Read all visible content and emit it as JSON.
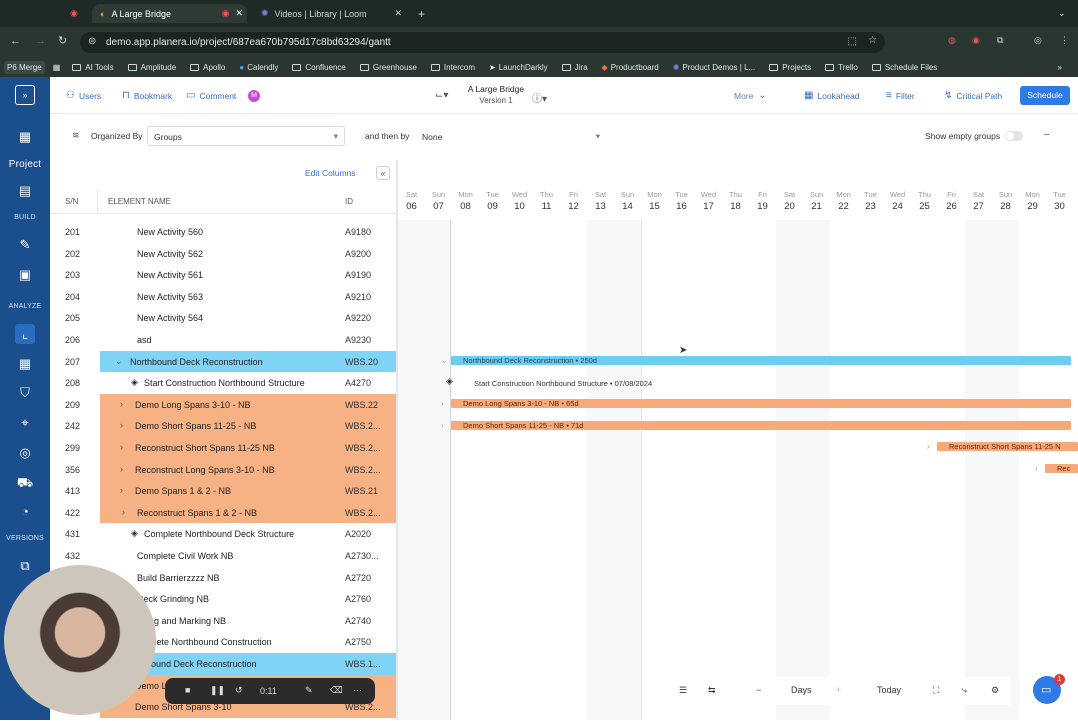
{
  "browser": {
    "tabs": [
      {
        "label": ""
      },
      {
        "label": "A Large Bridge"
      },
      {
        "label": "Videos | Library | Loom"
      }
    ],
    "url": "demo.app.planera.io/project/687ea670b795d17c8bd63294/gantt",
    "profile_label": "P6 Merge",
    "bookmarks": [
      "AI Tools",
      "Amplitude",
      "Apollo",
      "Calendly",
      "Confluence",
      "Greenhouse",
      "Intercom",
      "LaunchDarkly",
      "Jira",
      "Productboard",
      "Product Demos | L...",
      "Projects",
      "Trello",
      "Schedule Files"
    ]
  },
  "rail": {
    "project_label": "Project",
    "build_label": "BUILD",
    "analyze_label": "ANALYZE",
    "versions_label": "VERSIONS"
  },
  "toolbar": {
    "users": "Users",
    "bookmark": "Bookmark",
    "comment": "Comment",
    "avatar_letter": "M",
    "project_name": "A Large Bridge",
    "version": "Version 1",
    "more": "More",
    "lookahead": "Lookahead",
    "filter": "Filter",
    "critical_path": "Critical Path",
    "schedule": "Schedule"
  },
  "grouping": {
    "organized_by_label": "Organized By",
    "organized_by_value": "Groups",
    "then_by_label": "and then by",
    "then_by_value": "None",
    "show_empty_label": "Show empty groups"
  },
  "grid": {
    "edit_columns": "Edit Columns",
    "col_sn": "S/N",
    "col_name": "ELEMENT NAME",
    "col_id": "ID",
    "rows": [
      {
        "sn": "201",
        "name": "New Activity 560",
        "id": "A9180"
      },
      {
        "sn": "202",
        "name": "New Activity 562",
        "id": "A9200"
      },
      {
        "sn": "203",
        "name": "New Activity 561",
        "id": "A9190"
      },
      {
        "sn": "204",
        "name": "New Activity 563",
        "id": "A9210"
      },
      {
        "sn": "205",
        "name": "New Activity 564",
        "id": "A9220"
      },
      {
        "sn": "206",
        "name": "asd",
        "id": "A9230"
      },
      {
        "sn": "207",
        "name": "Northbound Deck Reconstruction",
        "id": "WBS.20"
      },
      {
        "sn": "208",
        "name": "Start Construction Northbound Structure",
        "id": "A4270"
      },
      {
        "sn": "209",
        "name": "Demo Long Spans 3-10 - NB",
        "id": "WBS.22"
      },
      {
        "sn": "242",
        "name": "Demo Short Spans 11-25 - NB",
        "id": "WBS.2..."
      },
      {
        "sn": "299",
        "name": "Reconstruct Short Spans 11-25 NB",
        "id": "WBS.2..."
      },
      {
        "sn": "356",
        "name": "Reconstruct Long Spans 3-10 - NB",
        "id": "WBS.2..."
      },
      {
        "sn": "413",
        "name": "Demo Spans 1 & 2 - NB",
        "id": "WBS.21"
      },
      {
        "sn": "422",
        "name": "Reconstruct Spans 1 & 2 - NB",
        "id": "WBS.2..."
      },
      {
        "sn": "431",
        "name": "Complete Northbound Deck Structure",
        "id": "A2020"
      },
      {
        "sn": "432",
        "name": "Complete Civil Work NB",
        "id": "A2730..."
      },
      {
        "sn": "",
        "name": "Build Barrierzzzz NB",
        "id": "A2720"
      },
      {
        "sn": "",
        "name": "Deck Grinding NB",
        "id": "A2760"
      },
      {
        "sn": "",
        "name": "riping and Marking NB",
        "id": "A2740"
      },
      {
        "sn": "",
        "name": "omplete Northbound Construction",
        "id": "A2750"
      },
      {
        "sn": "",
        "name": "bound Deck Reconstruction",
        "id": "WBS.1..."
      },
      {
        "sn": "",
        "name": "Demo L",
        "id": ""
      },
      {
        "sn": "",
        "name": "Demo Short Spans 3-10",
        "id": "WBS.2..."
      }
    ]
  },
  "timeline": {
    "days": [
      {
        "n": "Sat",
        "d": "06"
      },
      {
        "n": "Sun",
        "d": "07"
      },
      {
        "n": "Mon",
        "d": "08"
      },
      {
        "n": "Tue",
        "d": "09"
      },
      {
        "n": "Wed",
        "d": "10"
      },
      {
        "n": "Thu",
        "d": "11"
      },
      {
        "n": "Fri",
        "d": "12"
      },
      {
        "n": "Sat",
        "d": "13"
      },
      {
        "n": "Sun",
        "d": "14"
      },
      {
        "n": "Mon",
        "d": "15"
      },
      {
        "n": "Tue",
        "d": "16"
      },
      {
        "n": "Wed",
        "d": "17"
      },
      {
        "n": "Thu",
        "d": "18"
      },
      {
        "n": "Fri",
        "d": "19"
      },
      {
        "n": "Sat",
        "d": "20"
      },
      {
        "n": "Sun",
        "d": "21"
      },
      {
        "n": "Mon",
        "d": "22"
      },
      {
        "n": "Tue",
        "d": "23"
      },
      {
        "n": "Wed",
        "d": "24"
      },
      {
        "n": "Thu",
        "d": "25"
      },
      {
        "n": "Fri",
        "d": "26"
      },
      {
        "n": "Sat",
        "d": "27"
      },
      {
        "n": "Sun",
        "d": "28"
      },
      {
        "n": "Mon",
        "d": "29"
      },
      {
        "n": "Tue",
        "d": "30"
      }
    ],
    "bars": {
      "nb_deck": "Northbound Deck Reconstruction • 250d",
      "start_construction": "Start Construction Northbound Structure • 07/08/2024",
      "demo_long": "Demo Long Spans 3-10 - NB • 65d",
      "demo_short": "Demo Short Spans 11-25 - NB • 71d",
      "reconstruct_short": "Reconstruct Short Spans 11-25 N",
      "reconstruct_long": "Rec"
    }
  },
  "bottom": {
    "zoom_unit": "Days",
    "today": "Today",
    "recording_time": "0:11",
    "chat_badge": "1"
  },
  "colors": {
    "rail": "#1a4e8c",
    "wbs_blue": "#7fd3f5",
    "wbs_orange": "#f6b184",
    "accent": "#2f7be5"
  }
}
